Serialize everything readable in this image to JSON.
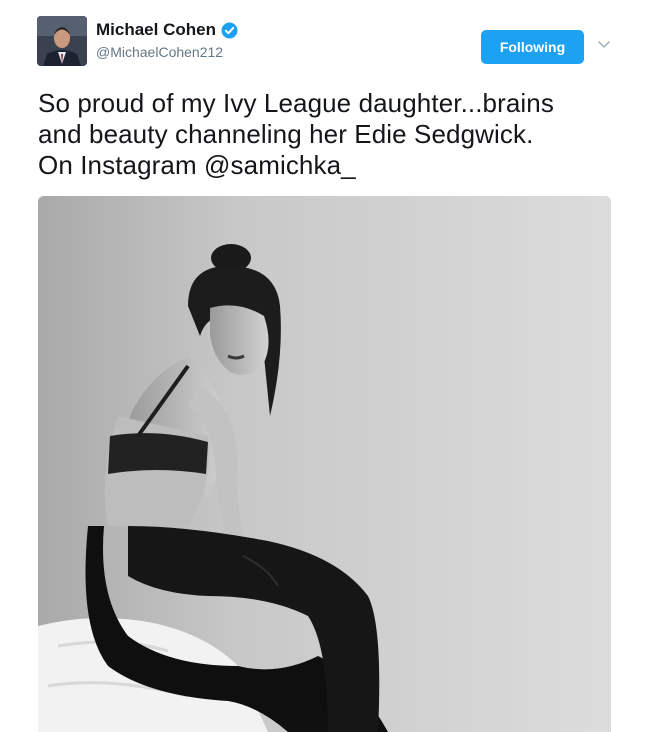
{
  "tweet": {
    "author_name": "Michael Cohen",
    "author_handle": "@MichaelCohen212",
    "verified_icon": "verified-badge-icon",
    "follow_label": "Following",
    "more_icon": "chevron-down-icon",
    "text_lines": [
      "So proud of my Ivy League daughter...brains",
      "and beauty channeling her Edie Sedgwick.",
      "On Instagram @samichka_"
    ]
  },
  "colors": {
    "accent": "#1da1f2",
    "name": "#14171a",
    "handle": "#657786"
  }
}
